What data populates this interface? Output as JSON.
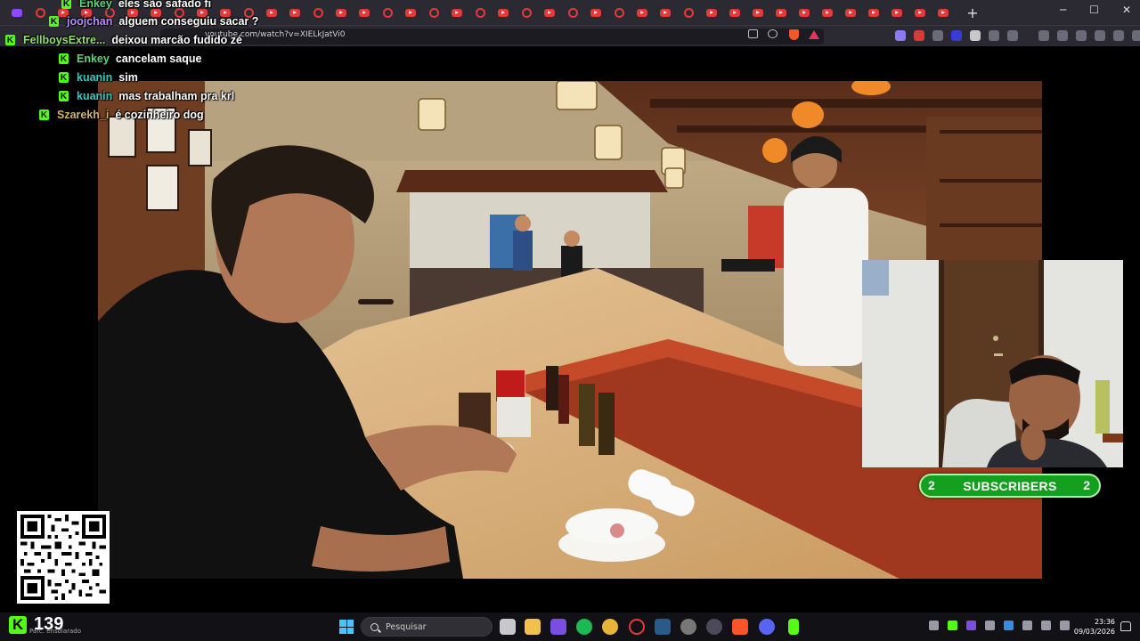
{
  "browser": {
    "url": "youtube.com/watch?v=XIELkJatVi0",
    "new_tab": "+",
    "win_min": "─",
    "win_max": "☐",
    "win_close": "✕"
  },
  "chat": {
    "messages": [
      {
        "user": "Enkey",
        "text": "eles são safado fi",
        "color": "#5ad57c"
      },
      {
        "user": "joojchan",
        "text": "alguem conseguiu sacar ?",
        "color": "#b78cff"
      },
      {
        "user": "FellboysExtre...",
        "text": "deixou marcão fudido zé",
        "color": "#8fe06c"
      },
      {
        "user": "Enkey",
        "text": "cancelam saque",
        "color": "#5ad57c"
      },
      {
        "user": "kuanin",
        "text": "sim",
        "color": "#39c6c0"
      },
      {
        "user": "kuanin",
        "text": "mas trabalham pra krl",
        "color": "#39c6c0"
      },
      {
        "user": "Szarekh_i",
        "text": "é cozinheiro dog",
        "color": "#d0b46a"
      }
    ],
    "badge_letter": "K"
  },
  "overlay": {
    "subscribers_label": "SUBSCRIBERS",
    "subscribers_left": "2",
    "subscribers_right": "2",
    "viewer_logo": "K",
    "viewer_count": "139"
  },
  "taskbar": {
    "weather_sub": "Parc. ensolarado",
    "search_placeholder": "Pesquisar",
    "time": "23:36",
    "date": "09/03/2026"
  },
  "colors": {
    "kick_green": "#53fc18",
    "subs_green": "#14a01e",
    "youtube_red": "#e53935"
  }
}
